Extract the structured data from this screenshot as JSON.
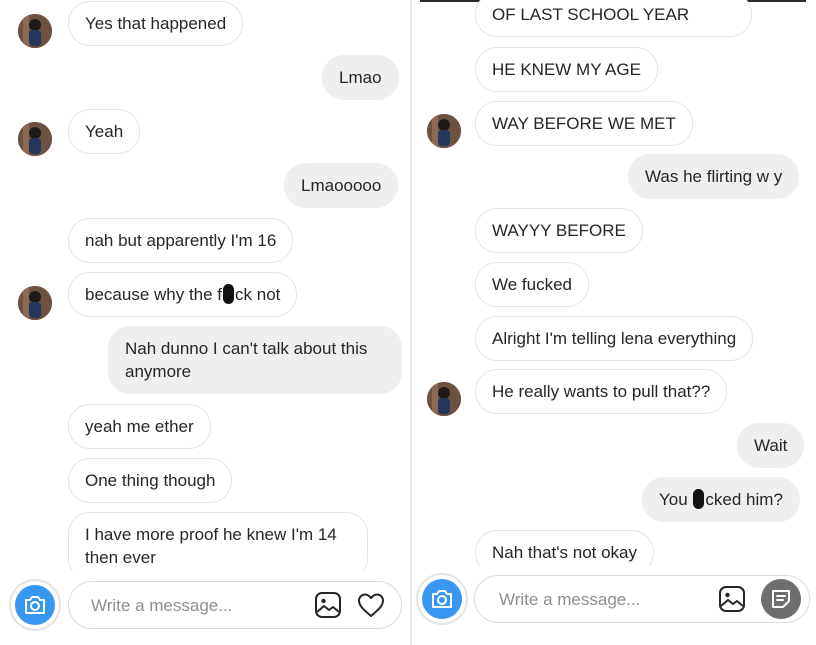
{
  "left_panel": {
    "messages": [
      {
        "dir": "in",
        "text": "Yes that happened"
      },
      {
        "dir": "out",
        "text": "Lmao"
      },
      {
        "dir": "in",
        "text": "Yeah"
      },
      {
        "dir": "out",
        "text": "Lmaooooo"
      },
      {
        "dir": "in",
        "text": "nah but apparently I'm 16"
      },
      {
        "dir": "in",
        "text_before": "because why the f",
        "text_after": "ck not"
      },
      {
        "dir": "out",
        "text": "Nah dunno I can't talk about this anymore"
      },
      {
        "dir": "in",
        "text": "yeah me ether"
      },
      {
        "dir": "in",
        "text": "One thing though"
      },
      {
        "dir": "in",
        "text": "I have more proof he knew I'm 14 then ever"
      }
    ],
    "composer": {
      "placeholder": "Write a message..."
    }
  },
  "right_panel": {
    "messages": [
      {
        "dir": "in",
        "text": "OF LAST SCHOOL YEAR"
      },
      {
        "dir": "in",
        "text": "HE KNEW MY AGE"
      },
      {
        "dir": "in",
        "text": "WAY BEFORE WE MET"
      },
      {
        "dir": "out",
        "text": "Was he flirting w y"
      },
      {
        "dir": "in",
        "text": "WAYYY BEFORE"
      },
      {
        "dir": "in",
        "text": "We fucked"
      },
      {
        "dir": "in",
        "text": "Alright I'm telling lena everything"
      },
      {
        "dir": "in",
        "text": "He really wants to pull that??"
      },
      {
        "dir": "out",
        "text": "Wait"
      },
      {
        "dir": "out",
        "text_before": "You ",
        "text_after": "cked him?"
      },
      {
        "dir": "in",
        "text": "Nah that's not okay"
      }
    ],
    "composer": {
      "placeholder": "Write a message..."
    }
  },
  "icons": {
    "camera": "camera-icon",
    "gallery": "image-icon",
    "like": "heart-icon",
    "sticker": "sticker-icon"
  },
  "colors": {
    "camera_button": "#3897f0",
    "outgoing_bubble": "#efefef",
    "incoming_border": "#e3e3e3",
    "placeholder": "#8e8e8e"
  }
}
